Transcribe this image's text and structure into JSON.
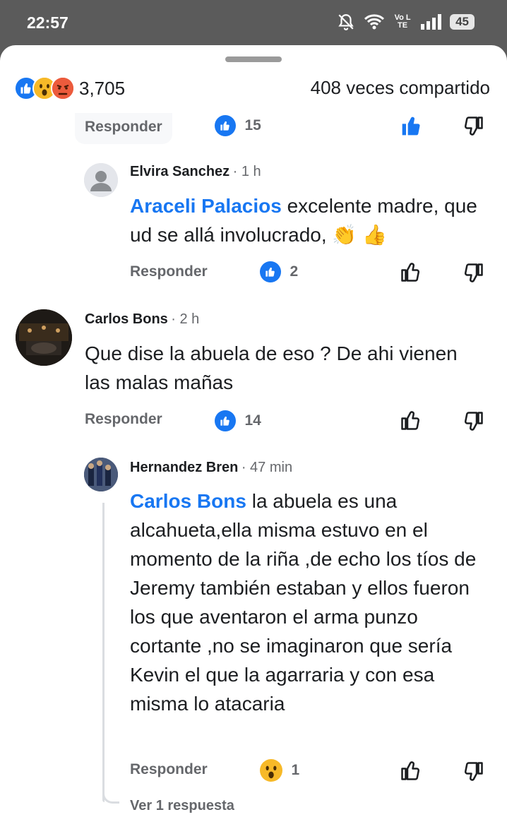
{
  "status_bar": {
    "time": "22:57",
    "network_label": "Vo LTE",
    "battery": "45"
  },
  "post_stats": {
    "reaction_count": "3,705",
    "shares": "408 veces compartido",
    "reaction_icons": [
      "like-icon",
      "wow-icon",
      "angry-icon"
    ]
  },
  "top_actions": {
    "reply_label": "Responder",
    "like_count": "15"
  },
  "comments": [
    {
      "author": "Elvira Sanchez",
      "time": "1 h",
      "mention": "Araceli Palacios",
      "text": "excelente  madre, que ud se allá involucrado, 👏 👍",
      "reply_label": "Responder",
      "reaction_count": "2"
    },
    {
      "author": "Carlos Bons",
      "time": "2 h",
      "text": "Que dise la abuela de eso ? De ahi vienen las malas mañas",
      "reply_label": "Responder",
      "reaction_count": "14"
    },
    {
      "author": "Hernandez Bren",
      "time": "47 min",
      "mention": "Carlos Bons",
      "text": "la abuela es una alcahueta,ella misma estuvo en el momento de la riña ,de echo los tíos de Jeremy también estaban y ellos fueron los que aventaron el arma punzo cortante ,no se imaginaron que sería Kevin el que la agarraria y con esa misma lo atacaria",
      "reply_label": "Responder",
      "reaction_count": "1",
      "more_replies": "Ver 1 respuesta"
    }
  ],
  "colors": {
    "accent": "#1877f2",
    "secondary_text": "#65676b"
  }
}
